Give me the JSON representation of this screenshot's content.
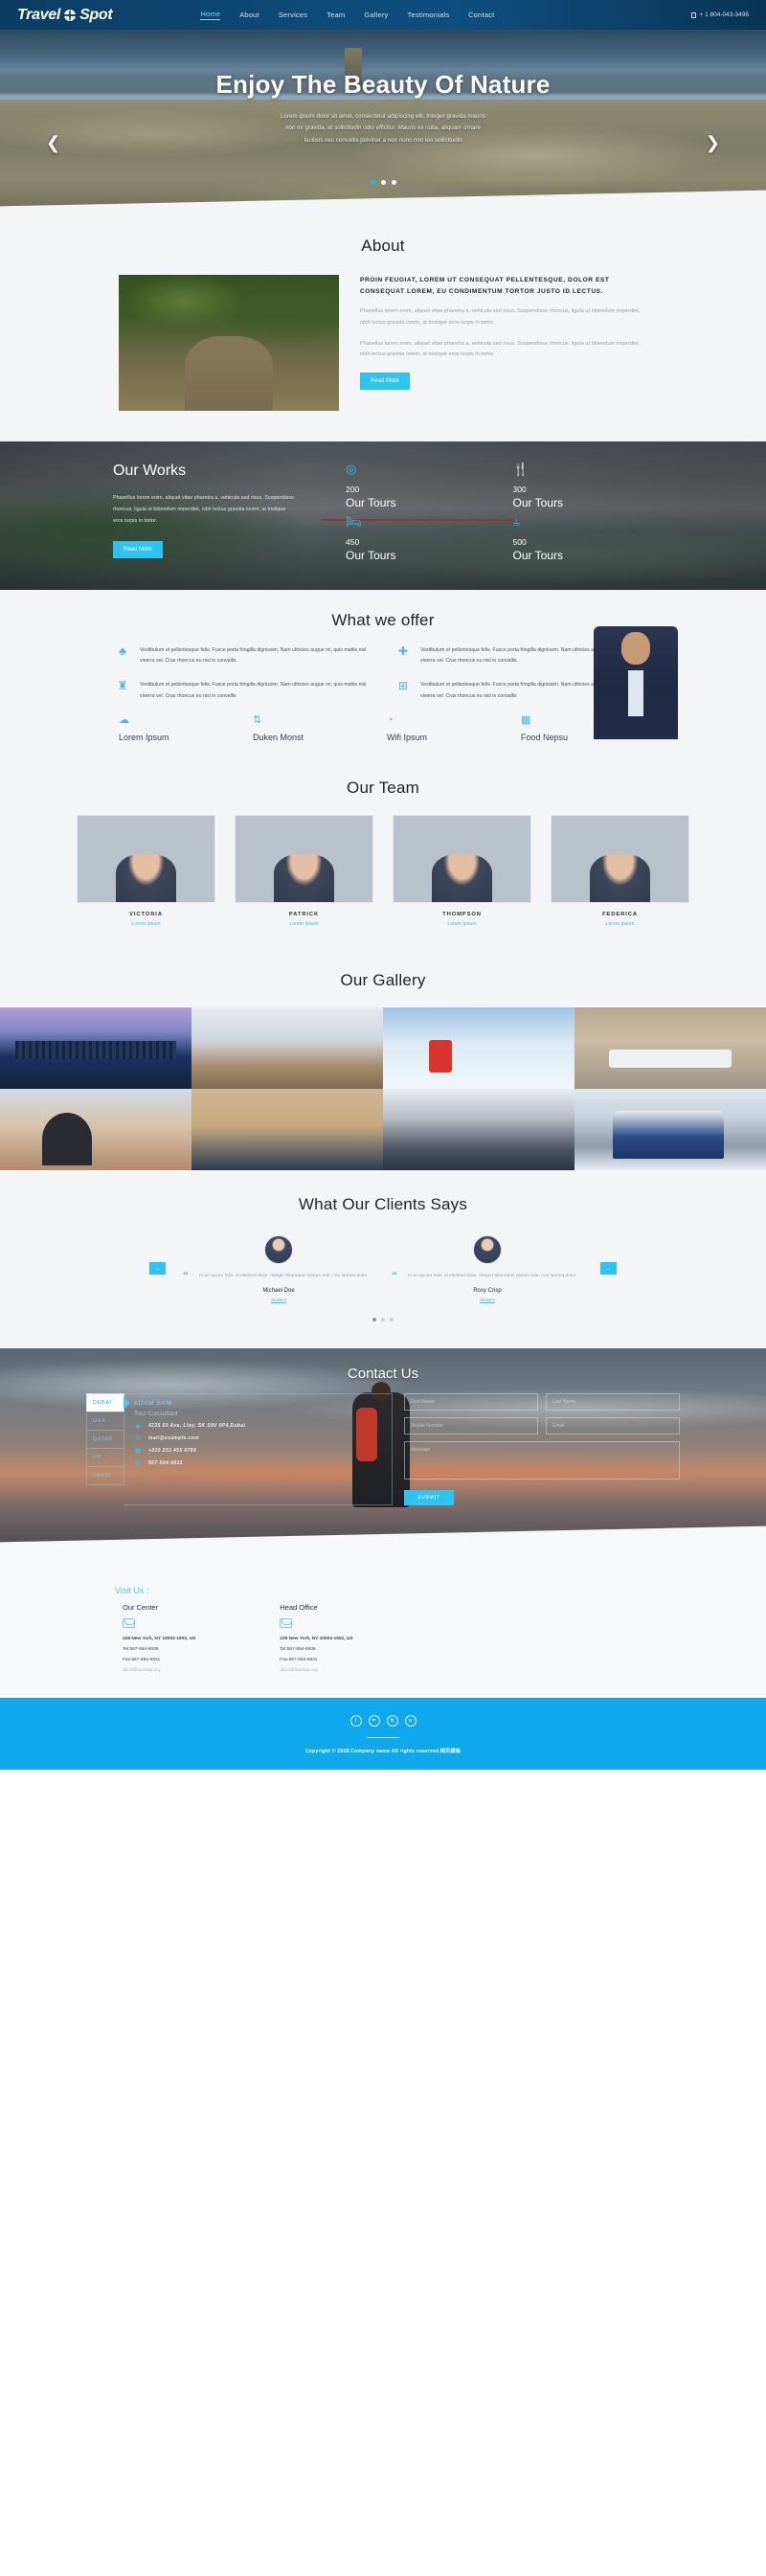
{
  "header": {
    "brand": {
      "part1": "Travel",
      "part2": "Spot",
      "globe_icon": "globe-icon"
    },
    "nav": [
      {
        "label": "Home",
        "active": true
      },
      {
        "label": "About",
        "active": false
      },
      {
        "label": "Services",
        "active": false
      },
      {
        "label": "Team",
        "active": false
      },
      {
        "label": "Gallery",
        "active": false
      },
      {
        "label": "Testimonials",
        "active": false
      },
      {
        "label": "Contact",
        "active": false
      }
    ],
    "phone": "+ 1 804-043-3496"
  },
  "hero": {
    "title": "Enjoy The Beauty Of Nature",
    "subtitle": "Lorem ipsum dolor sit amet, consectetur adipiscing elit. Integer gravida mauris non mi gravida, at sollicitudin odio efficitur. Mauris ex nulla, aliquam ornare facilisis nec convallis pulvinar a non nunc non leo sollicitudin",
    "prev_icon": "chevron-left-icon",
    "next_icon": "chevron-right-icon",
    "dots": 3,
    "active_dot": 0
  },
  "about": {
    "title": "About",
    "heading": "PROIN FEUGIAT, LOREM UT CONSEQUAT PELLENTESQUE, DOLOR EST CONSEQUAT LOREM, EU CONDIMENTUM TORTOR JUSTO ID LECTUS.",
    "paragraph1": "Phasellus lorem enim, aliquet vitae pharetra a, vehicula sed risus. Suspendisse rhoncus, ligula ut bibendum imperdiet, nibh lectus gravida lorem, at tristique eros turpis in tortor.",
    "paragraph2": "Phasellus lorem enim, aliquet vitae pharetra a, vehicula sed risus. Suspendisse rhoncus, ligula ut bibendum imperdiet, nibh lectus gravida lorem, at tristique eros turpis in tortor.",
    "button": "Read More"
  },
  "works": {
    "title": "Our Works",
    "paragraph": "Phasellus lorem enim, aliquet vitae pharetra a, vehicula sed risus. Suspendisse rhoncus, ligula ut bibendum imperdiet, nibh lectus gravida lorem, at tristique eros turpis in tortor.",
    "button": "Read More",
    "stats": [
      {
        "icon": "tripadvisor-icon",
        "glyph": "◎",
        "number": "200",
        "label": "Our Tours"
      },
      {
        "icon": "cutlery-icon",
        "glyph": "🍴",
        "number": "300",
        "label": "Our Tours"
      },
      {
        "icon": "bed-icon",
        "glyph": "🛏",
        "number": "450",
        "label": "Our Tours"
      },
      {
        "icon": "signpost-icon",
        "glyph": "⫨",
        "number": "500",
        "label": "Our Tours"
      }
    ]
  },
  "offer": {
    "title": "What we offer",
    "cells": [
      {
        "icon": "leaf-icon",
        "glyph": "♣",
        "text": "Vestibulum et pellentesque felis. Fusce porta fringilla dignissim. Nam ultricies augue mi, quis mattis nisl viverra vel. Cras rhoncus eu nisl in convallis"
      },
      {
        "icon": "arrows-move-icon",
        "glyph": "✚",
        "text": "Vestibulum et pellentesque felis. Fusce porta fringilla dignissim. Nam ultricies augue mi, quis mattis nisl viverra vel. Cras rhoncus eu nisl in convallis"
      },
      {
        "icon": "castle-icon",
        "glyph": "♜",
        "text": "Vestibulum et pellentesque felis. Fusce porta fringilla dignissim. Nam ultricies augue mi, quis mattis nisl viverra vel. Cras rhoncus eu nisl in convallis"
      },
      {
        "icon": "train-icon",
        "glyph": "⊞",
        "text": "Vestibulum et pellentesque felis. Fusce porta fringilla dignissim. Nam ultricies augue mi, quis mattis nisl viverra vel. Cras rhoncus eu nisl in convallis"
      }
    ],
    "features": [
      {
        "icon": "cloud-icon",
        "glyph": "☁",
        "title": "Lorem Ipsum"
      },
      {
        "icon": "sort-numeric-icon",
        "glyph": "⇅",
        "title": "Duken Monst"
      },
      {
        "icon": "wifi-icon",
        "glyph": "◔",
        "title": "Wifi Ipsum"
      },
      {
        "icon": "grid-icon",
        "glyph": "▩",
        "title": "Food Nepsu"
      }
    ],
    "man_photo": "businessman-photo"
  },
  "team": {
    "title": "Our Team",
    "members": [
      {
        "name": "VICTORIA",
        "role": "Lorem Ipsum"
      },
      {
        "name": "PATRICK",
        "role": "Lorem Ipsum"
      },
      {
        "name": "THOMPSON",
        "role": "Lorem Ipsum"
      },
      {
        "name": "FEDERICA",
        "role": "Lorem Ipsum"
      }
    ]
  },
  "gallery": {
    "title": "Our Gallery",
    "images": [
      "city-skyline-photo",
      "hikers-mountain-photo",
      "snow-family-photo",
      "street-tram-photo",
      "woman-camera-photo",
      "travel-flatlay-photo",
      "airplane-cabin-photo",
      "winter-tram-photo"
    ]
  },
  "testimonials": {
    "title": "What Our Clients Says",
    "prev_icon": "arrow-left-icon",
    "next_icon": "arrow-right-icon",
    "prev_glyph": "←",
    "next_glyph": "→",
    "items": [
      {
        "quote": "In eu auctor felis, id eleifend dolor. Integer bibendum dictum erat, non laoreet dolor.",
        "name": "Michael Doe",
        "role": "Student"
      },
      {
        "quote": "In eu auctor felis, id eleifend dolor. Integer bibendum dictum erat, non laoreet dolor.",
        "name": "Rosy Crisp",
        "role": "Student"
      }
    ],
    "dots": 3,
    "active_dot": 0
  },
  "contact": {
    "title": "Contact Us",
    "tabs": [
      {
        "label": "DUBAI",
        "active": true
      },
      {
        "label": "USA",
        "active": false
      },
      {
        "label": "QATAR",
        "active": false
      },
      {
        "label": "UK",
        "active": false
      },
      {
        "label": "PARIS",
        "active": false
      }
    ],
    "person_name": "ADAM SAM",
    "person_role": "Tour Consultant",
    "details": [
      {
        "icon": "map-marker-icon",
        "glyph": "◉",
        "text": "4235 50 Ave, Lloy, SK S9V 0P4,Dubai"
      },
      {
        "icon": "envelope-icon",
        "glyph": "✉",
        "text": "mail@example.com"
      },
      {
        "icon": "phone-icon",
        "glyph": "☎",
        "text": "+010 233 455 6789"
      },
      {
        "icon": "fax-icon",
        "glyph": "⎙",
        "text": "567-594-6931"
      }
    ],
    "form": {
      "first_name_placeholder": "First Name",
      "last_name_placeholder": "Last Name",
      "mobile_placeholder": "Mobile Number",
      "email_placeholder": "Email",
      "message_placeholder": "Message",
      "submit_label": "SUBMIT"
    }
  },
  "visit": {
    "title": "Visit Us :",
    "offices": [
      {
        "name": "Our Center",
        "icon": "envelope-icon",
        "address": "228 New York, NY 10003-1903, US",
        "tel": "Tel:567-594-6939",
        "fax": "Fax:567-594-6931",
        "email": "abcd@toursap.org"
      },
      {
        "name": "Head Office",
        "icon": "envelope-icon",
        "address": "228 New York, NY 10003-1502, US",
        "tel": "Tel:567-594-6939",
        "fax": "Fax:567-594-6931",
        "email": "abcd@toursap.org"
      }
    ]
  },
  "footer": {
    "socials": [
      {
        "icon": "facebook-icon",
        "glyph": "f"
      },
      {
        "icon": "twitter-icon",
        "glyph": "✒"
      },
      {
        "icon": "rss-icon",
        "glyph": "≋"
      },
      {
        "icon": "vk-icon",
        "glyph": "ᴡ"
      }
    ],
    "copyright": "Copyright © 2018.Company name All rights reserved.网页模板"
  },
  "colors": {
    "accent": "#2ec4f1",
    "footer_bg": "#0fa8ec",
    "header_bg": "#0d4a78",
    "section_bg": "#f3f5f6"
  }
}
